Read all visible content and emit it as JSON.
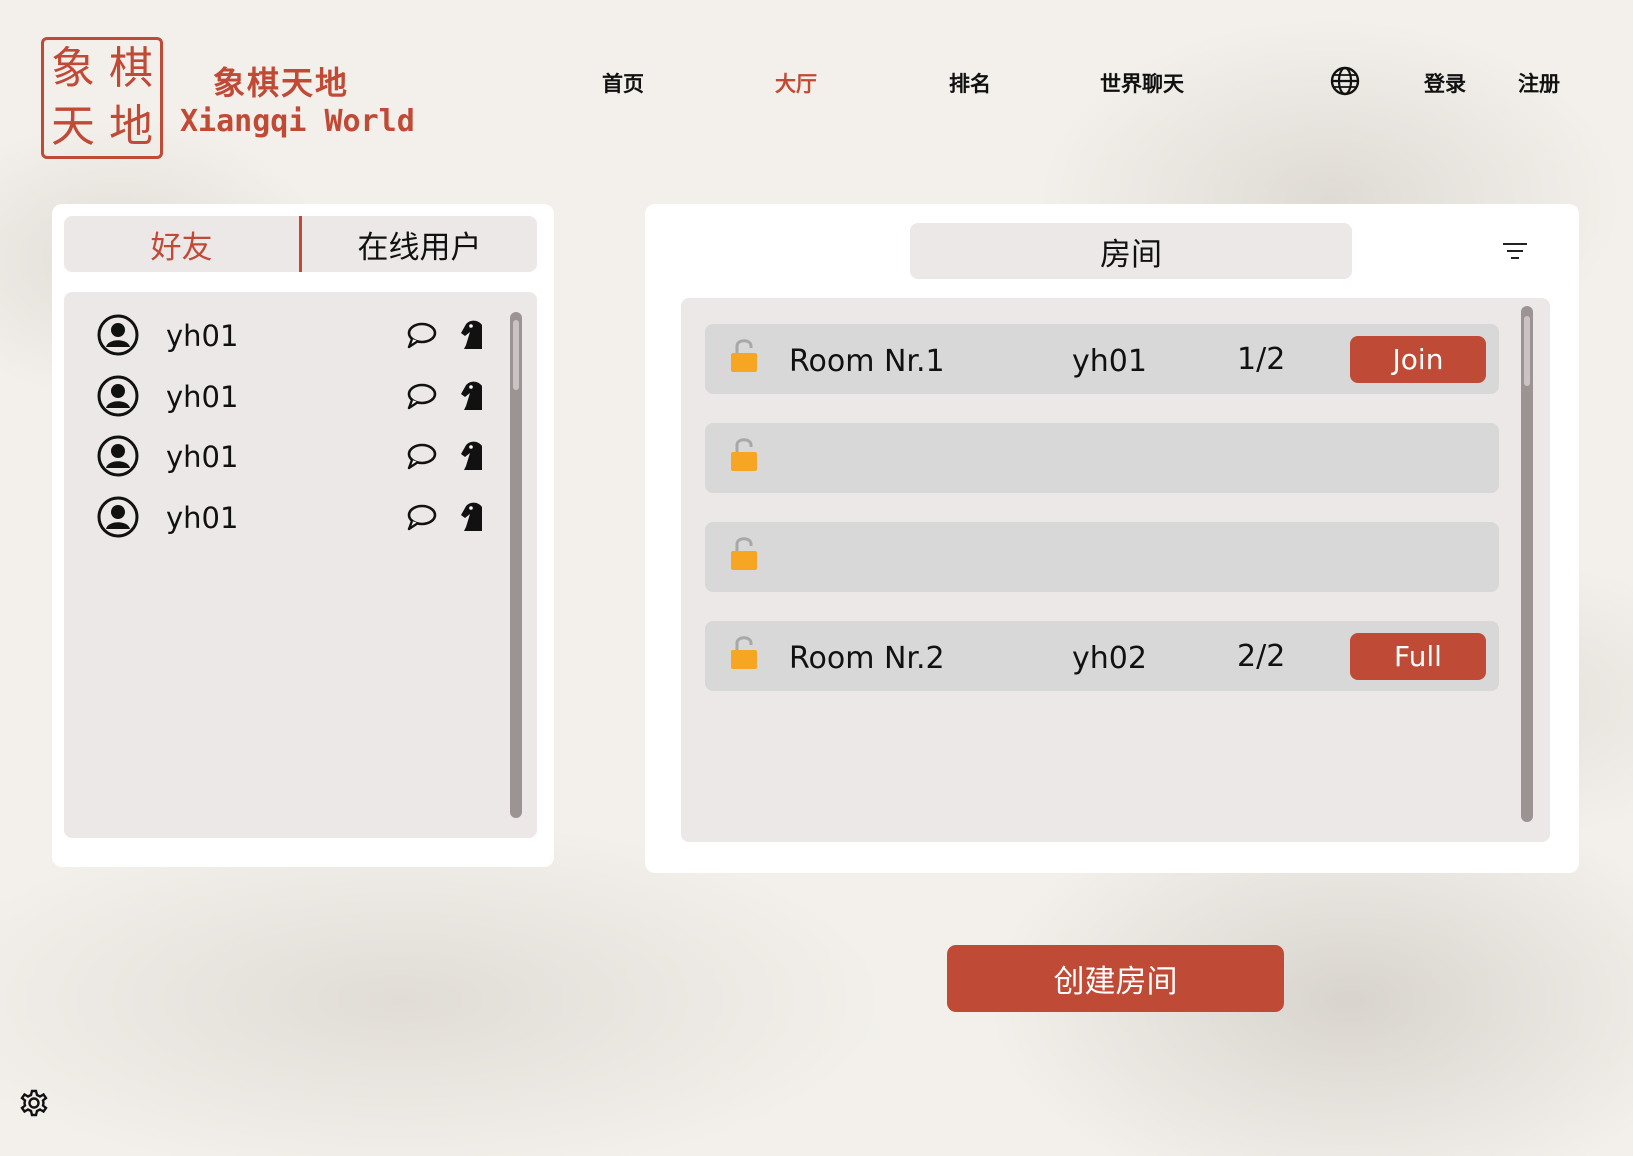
{
  "logo": {
    "seal_chars": [
      "象",
      "棋",
      "天",
      "地"
    ],
    "title_cn": "象棋天地",
    "title_en": "Xiangqi World"
  },
  "nav": {
    "items": [
      {
        "label": "首页"
      },
      {
        "label": "大厅",
        "active": true
      },
      {
        "label": "排名"
      },
      {
        "label": "世界聊天"
      }
    ],
    "language_icon": "globe-icon",
    "login": "登录",
    "register": "注册"
  },
  "left_panel": {
    "tabs": [
      {
        "label": "好友",
        "active": true
      },
      {
        "label": "在线用户"
      }
    ],
    "friends": [
      {
        "name": "yh01"
      },
      {
        "name": "yh01"
      },
      {
        "name": "yh01"
      },
      {
        "name": "yh01"
      }
    ]
  },
  "right_panel": {
    "tab_label": "房间",
    "filter_icon": "filter-icon",
    "rooms": [
      {
        "name": "Room Nr.1",
        "host": "yh01",
        "players": "1/2",
        "action": "Join"
      },
      {
        "name": "",
        "host": "",
        "players": "",
        "action": ""
      },
      {
        "name": "",
        "host": "",
        "players": "",
        "action": ""
      },
      {
        "name": "Room Nr.2",
        "host": "yh02",
        "players": "2/2",
        "action": "Full"
      }
    ]
  },
  "create_room": "创建房间",
  "colors": {
    "accent": "#bf4a35",
    "lock": "#f6a623",
    "panel": "#ece8e7",
    "row": "#d8d8d8"
  }
}
